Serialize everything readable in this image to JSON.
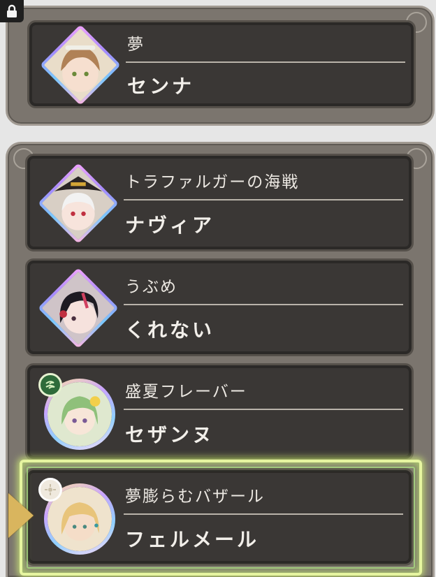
{
  "top_entry": {
    "title": "夢",
    "name": "センナ"
  },
  "entries": [
    {
      "title": "トラファルガーの海戦",
      "name": "ナヴィア"
    },
    {
      "title": "うぶめ",
      "name": "くれない"
    },
    {
      "title": "盛夏フレーバー",
      "name": "セザンヌ"
    },
    {
      "title": "夢膨らむバザール",
      "name": "フェルメール"
    }
  ],
  "icons": {
    "lock": "lock-icon",
    "wind_element": "wind-element-icon",
    "light_element": "light-element-icon",
    "selection_pointer": "selection-arrow-icon"
  },
  "colors": {
    "background": "#e6e6e6",
    "panel": "#7b756e",
    "card": "#3a3735",
    "text": "#ece8e2",
    "selection_glow": "#e6f5a0",
    "pointer": "#d9b55e"
  }
}
